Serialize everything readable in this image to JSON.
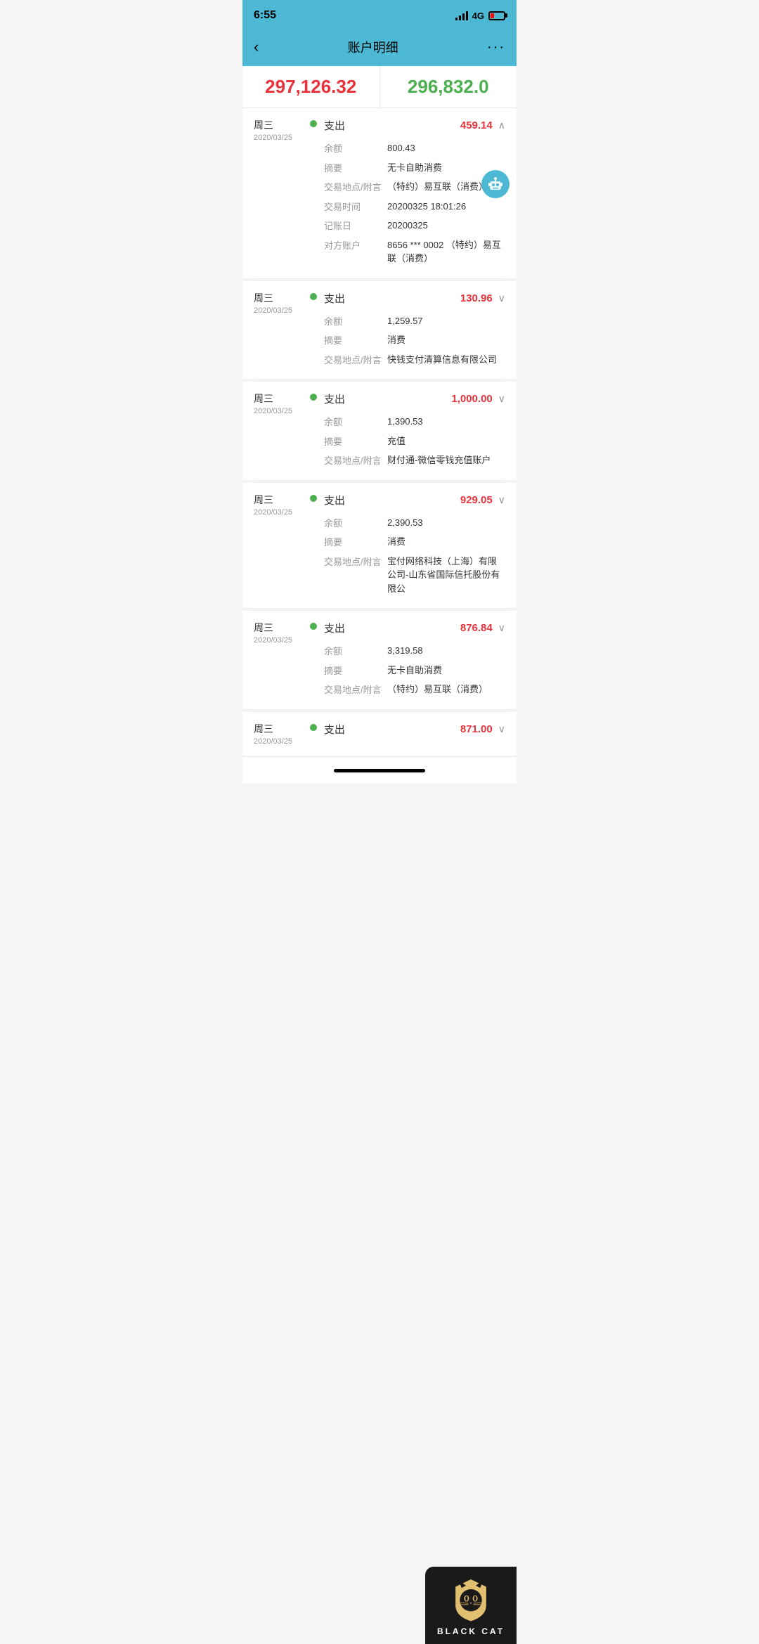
{
  "statusBar": {
    "time": "6:55",
    "network": "4G"
  },
  "nav": {
    "back": "‹",
    "title": "账户明细",
    "more": "···"
  },
  "balances": {
    "left": "297,126.32",
    "right": "296,832.0"
  },
  "transactions": [
    {
      "dayOfWeek": "周三",
      "date": "2020/03/25",
      "type": "支出",
      "amount": "459.14",
      "expanded": true,
      "details": [
        {
          "label": "余额",
          "value": "800.43"
        },
        {
          "label": "摘要",
          "value": "无卡自助消费"
        },
        {
          "label": "交易地点/附言",
          "value": "（特约）易互联（消费）"
        },
        {
          "label": "交易时间",
          "value": "20200325 18:01:26"
        },
        {
          "label": "记账日",
          "value": "20200325"
        },
        {
          "label": "对方账户",
          "value": "8656 *** 0002 （特约）易互联（消费）"
        }
      ]
    },
    {
      "dayOfWeek": "周三",
      "date": "2020/03/25",
      "type": "支出",
      "amount": "130.96",
      "expanded": false,
      "details": [
        {
          "label": "余额",
          "value": "1,259.57"
        },
        {
          "label": "摘要",
          "value": "消费"
        },
        {
          "label": "交易地点/附言",
          "value": "快钱支付清算信息有限公司"
        }
      ]
    },
    {
      "dayOfWeek": "周三",
      "date": "2020/03/25",
      "type": "支出",
      "amount": "1,000.00",
      "expanded": false,
      "details": [
        {
          "label": "余额",
          "value": "1,390.53"
        },
        {
          "label": "摘要",
          "value": "充值"
        },
        {
          "label": "交易地点/附言",
          "value": "财付通-微信零钱充值账户"
        }
      ]
    },
    {
      "dayOfWeek": "周三",
      "date": "2020/03/25",
      "type": "支出",
      "amount": "929.05",
      "expanded": false,
      "details": [
        {
          "label": "余额",
          "value": "2,390.53"
        },
        {
          "label": "摘要",
          "value": "消费"
        },
        {
          "label": "交易地点/附言",
          "value": "宝付网络科技（上海）有限公司-山东省国际信托股份有限公"
        }
      ]
    },
    {
      "dayOfWeek": "周三",
      "date": "2020/03/25",
      "type": "支出",
      "amount": "876.84",
      "expanded": false,
      "details": [
        {
          "label": "余额",
          "value": "3,319.58"
        },
        {
          "label": "摘要",
          "value": "无卡自助消费"
        },
        {
          "label": "交易地点/附言",
          "value": "（特约）易互联（消费）"
        }
      ]
    },
    {
      "dayOfWeek": "周三",
      "date": "2020/03/25",
      "type": "支出",
      "amount": "871.00",
      "expanded": false,
      "details": []
    }
  ],
  "blackCat": {
    "label": "BLACK CAT"
  }
}
